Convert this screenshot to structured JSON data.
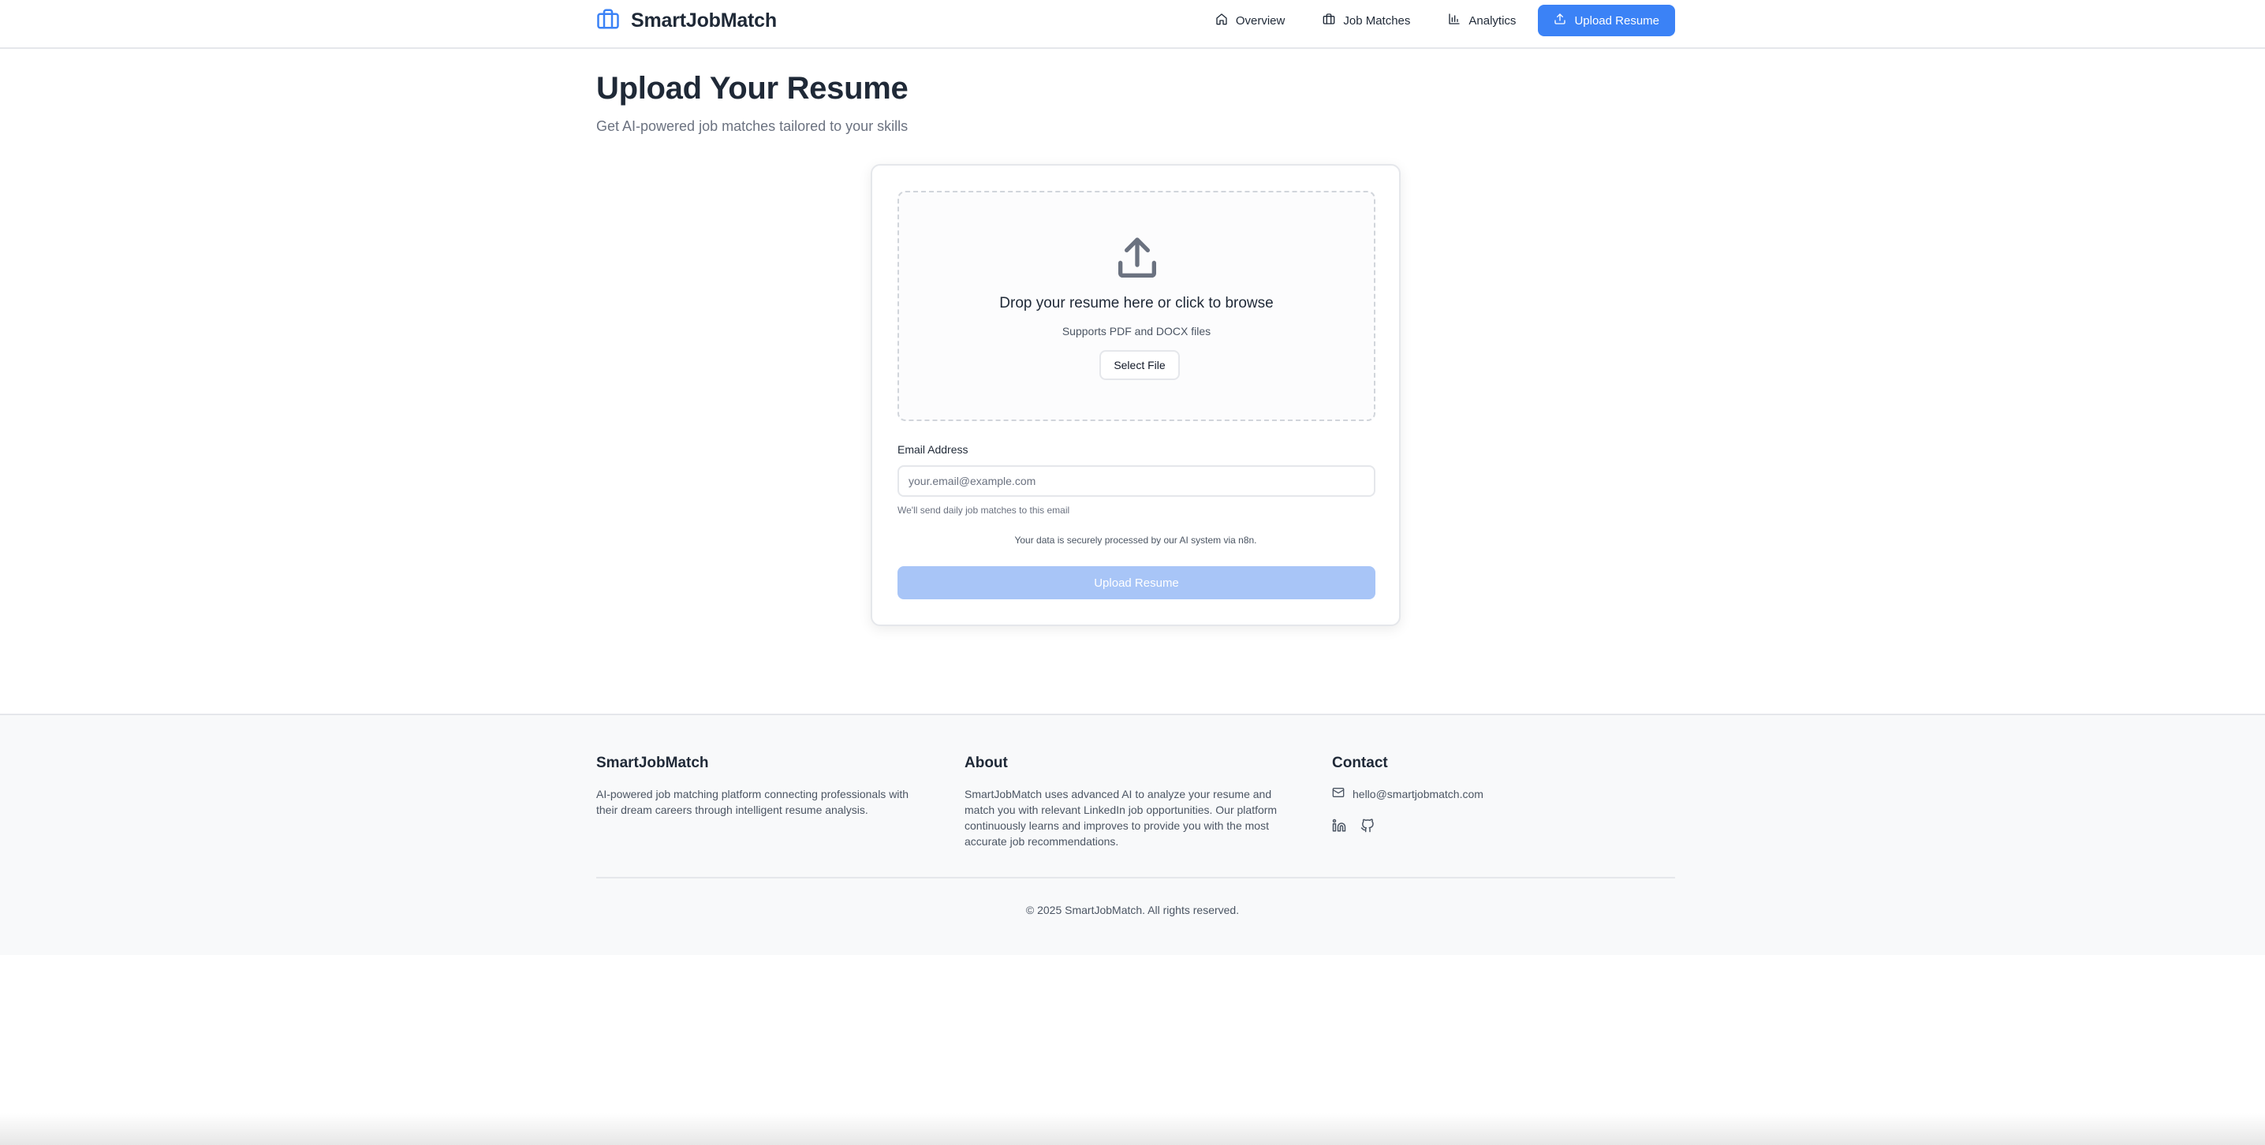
{
  "brand": {
    "name": "SmartJobMatch",
    "icon": "briefcase-icon"
  },
  "nav": {
    "items": [
      {
        "label": "Overview",
        "icon": "home-icon"
      },
      {
        "label": "Job Matches",
        "icon": "briefcase-icon"
      },
      {
        "label": "Analytics",
        "icon": "bar-chart-icon"
      },
      {
        "label": "Upload Resume",
        "icon": "upload-icon",
        "active": true
      }
    ]
  },
  "page": {
    "title": "Upload Your Resume",
    "subtitle": "Get AI-powered job matches tailored to your skills"
  },
  "upload": {
    "icon": "upload-icon",
    "drop_title": "Drop your resume here or click to browse",
    "drop_subtitle": "Supports PDF and DOCX files",
    "select_label": "Select File",
    "email_label": "Email Address",
    "email_placeholder": "your.email@example.com",
    "email_value": "",
    "email_hint": "We'll send daily job matches to this email",
    "privacy_note": "Your data is securely processed by our AI system via n8n.",
    "submit_label": "Upload Resume"
  },
  "footer": {
    "col1": {
      "title": "SmartJobMatch",
      "text": "AI-powered job matching platform connecting professionals with their dream careers through intelligent resume analysis."
    },
    "col2": {
      "title": "About",
      "text": "SmartJobMatch uses advanced AI to analyze your resume and match you with relevant LinkedIn job opportunities. Our platform continuously learns and improves to provide you with the most accurate job recommendations."
    },
    "col3": {
      "title": "Contact",
      "email": "hello@smartjobmatch.com",
      "social": [
        "linkedin-icon",
        "github-icon"
      ]
    },
    "copyright": "© 2025 SmartJobMatch. All rights reserved."
  },
  "colors": {
    "accent": "#3b82f6",
    "accent_disabled": "#a8c5f7",
    "text_primary": "#1f2937",
    "text_muted": "#6b7280",
    "footer_bg": "#f8f9fa"
  }
}
